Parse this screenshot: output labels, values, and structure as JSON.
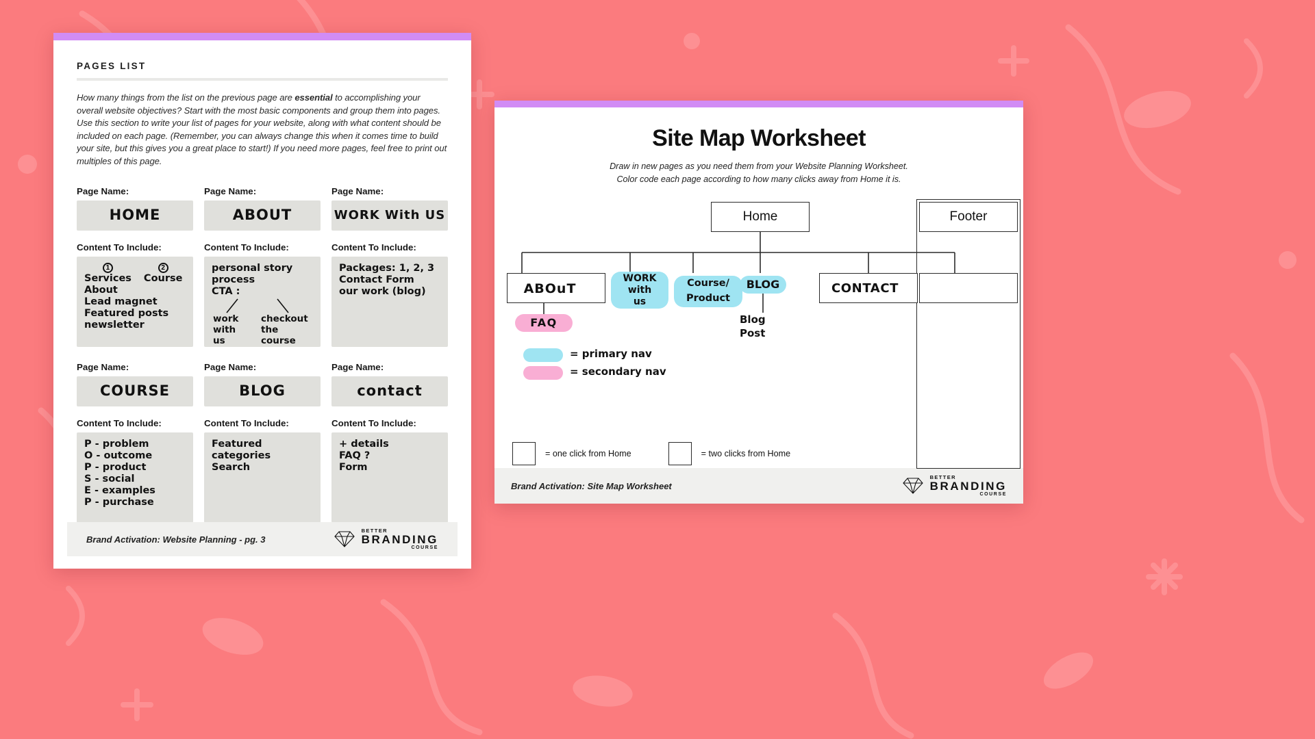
{
  "background": {
    "color": "#fb7b7e",
    "accent_purple": "#d18cf5"
  },
  "pages_sheet": {
    "section_label": "PAGES LIST",
    "intro_parts": {
      "a": "How many things from the list on the previous page are ",
      "bold": "essential",
      "b": " to accomplishing your overall website objectives? Start with the most basic components and group them into pages. Use this section to write your list of pages for your website, along with what content should be included on each page. (Remember, you can always change this when it comes time to build your site, but this gives you a great place to start!) If you need more pages, feel free to print out multiples of this page."
    },
    "field_labels": {
      "page_name": "Page Name:",
      "content": "Content To Include:"
    },
    "cells": [
      {
        "page_name": "HOME",
        "content_lines": [
          "Services",
          "About",
          "Lead magnet",
          "Featured posts",
          "newsletter"
        ],
        "marker_1": "1",
        "marker_2": "2",
        "marker_2_text": "Course"
      },
      {
        "page_name": "ABOUT",
        "content_lines": [
          "personal story",
          "process",
          "CTA :"
        ],
        "cta_left": "work\nwith\nus",
        "cta_right": "checkout\nthe\ncourse"
      },
      {
        "page_name": "WORK With US",
        "content_lines": [
          "Packages: 1, 2, 3",
          "Contact Form",
          "our work (blog)"
        ]
      },
      {
        "page_name": "COURSE",
        "content_lines": [
          "P - problem",
          "O - outcome",
          "P - product",
          "S - social",
          "E - examples",
          "P - purchase"
        ]
      },
      {
        "page_name": "BLOG",
        "content_lines": [
          "Featured",
          "categories",
          "Search"
        ]
      },
      {
        "page_name": "contact",
        "content_lines": [
          "+ details",
          "   FAQ ?",
          "  Form"
        ]
      }
    ],
    "footer_text": "Brand Activation: Website Planning - pg. 3"
  },
  "sitemap_sheet": {
    "title": "Site Map Worksheet",
    "subtitle_line1": "Draw in new pages as you need them from your Website Planning Worksheet.",
    "subtitle_line2": "Color code each page according to how many clicks away from Home it is.",
    "nodes": {
      "home": "Home",
      "footer": "Footer",
      "about": "ABOuT",
      "contact": "CONTACT",
      "work_with_us": "WORK\nwith\nus",
      "course_product": "Course/\nProduct",
      "blog": "BLOG",
      "faq": "FAQ",
      "blog_post": "Blog\nPost"
    },
    "color_legend": [
      {
        "swatch": "cyan",
        "color": "#9fe4f2",
        "label": "= primary nav"
      },
      {
        "swatch": "pink",
        "color": "#f9aed4",
        "label": "= secondary nav"
      }
    ],
    "click_legend": [
      {
        "label": "= one click from Home"
      },
      {
        "label": "= two clicks from Home"
      }
    ],
    "footer_text": "Brand Activation: Site Map Worksheet"
  },
  "brand": {
    "better": "BETTER",
    "branding": "BRANDING",
    "course": "COURSE",
    "icon": "diamond-icon"
  }
}
